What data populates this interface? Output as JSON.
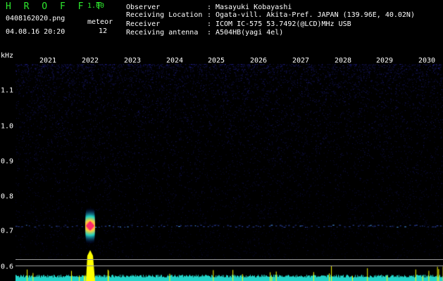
{
  "app": {
    "title": "H R O F F T",
    "version": "1.00",
    "filename": "0408162020.png",
    "timestamp": "04.08.16 20:20",
    "meteor_label": "meteor",
    "meteor_count": "12"
  },
  "info": [
    {
      "key": "Observer",
      "sep": ":",
      "value": "Masayuki Kobayashi"
    },
    {
      "key": "Receiving Location",
      "sep": ":",
      "value": "Ogata-vill. Akita-Pref. JAPAN (139.96E, 40.02N)"
    },
    {
      "key": "Receiver",
      "sep": ":",
      "value": "ICOM IC-575 53.7492(@LCD)MHz USB"
    },
    {
      "key": "Receiving antenna",
      "sep": ":",
      "value": "A504HB(yagi 4el)"
    }
  ],
  "axis": {
    "unit": "kHz",
    "x_ticks": [
      "2021",
      "2022",
      "2023",
      "2024",
      "2025",
      "2026",
      "2027",
      "2028",
      "2029",
      "2030"
    ],
    "y_ticks": [
      "1.1",
      "1.0",
      "0.9",
      "0.8",
      "0.7",
      "0.6"
    ]
  },
  "chart_data": {
    "type": "heatmap",
    "x_tick_labels": [
      "2021",
      "2022",
      "2023",
      "2024",
      "2025",
      "2026",
      "2027",
      "2028",
      "2029",
      "2030"
    ],
    "ylabel": "kHz",
    "y_tick_labels": [
      "1.1",
      "1.0",
      "0.9",
      "0.8",
      "0.7",
      "0.6"
    ],
    "ylim": [
      0.59,
      1.2
    ],
    "carrier_frequency_khz": 0.745,
    "strong_echo": {
      "time_label": "2022",
      "freq_khz": 0.745
    },
    "colors": {
      "noise": "#1a1a8c",
      "echo": "#ff2a6a",
      "power_trace": "#ffff00",
      "base_trace": "#22d3c8"
    }
  },
  "colors": {
    "accent": "#2ee82e",
    "background": "#000000",
    "text": "#ffffff"
  }
}
